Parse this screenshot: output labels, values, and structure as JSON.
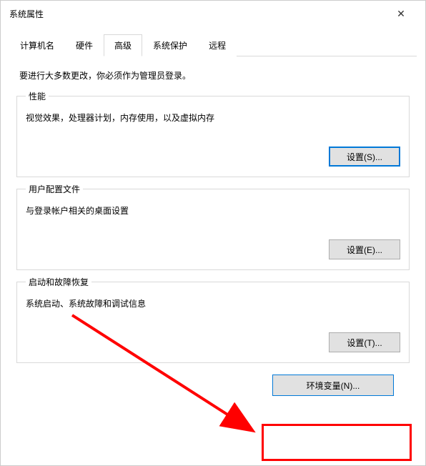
{
  "titlebar": {
    "title": "系统属性",
    "close": "✕"
  },
  "tabs": {
    "computerName": "计算机名",
    "hardware": "硬件",
    "advanced": "高级",
    "systemProtection": "系统保护",
    "remote": "远程"
  },
  "content": {
    "intro": "要进行大多数更改，你必须作为管理员登录。",
    "performance": {
      "legend": "性能",
      "desc": "视觉效果，处理器计划，内存使用，以及虚拟内存",
      "button": "设置(S)..."
    },
    "userProfiles": {
      "legend": "用户配置文件",
      "desc": "与登录帐户相关的桌面设置",
      "button": "设置(E)..."
    },
    "startup": {
      "legend": "启动和故障恢复",
      "desc": "系统启动、系统故障和调试信息",
      "button": "设置(T)..."
    },
    "envButton": "环境变量(N)..."
  }
}
